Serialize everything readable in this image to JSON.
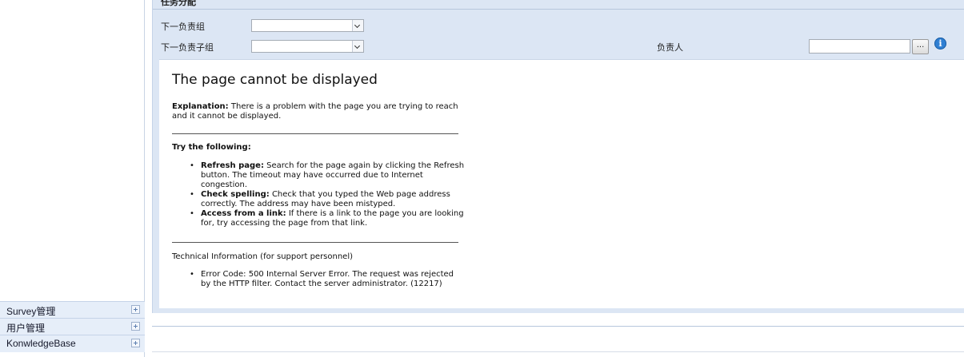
{
  "panel": {
    "title": "任务分配",
    "next_group_label": "下一负责组",
    "next_group_value": "",
    "next_subgroup_label": "下一负责子组",
    "next_subgroup_value": "",
    "owner_label": "负责人",
    "owner_value": "",
    "browse_label": "...",
    "info_glyph": "i"
  },
  "error_page": {
    "title": "The page cannot be displayed",
    "explanation_label": "Explanation:",
    "explanation_text": "There is a problem with the page you are trying to reach and it cannot be displayed.",
    "try_heading": "Try the following:",
    "tips": [
      {
        "label": "Refresh page:",
        "text": "Search for the page again by clicking the Refresh button. The timeout may have occurred due to Internet congestion."
      },
      {
        "label": "Check spelling:",
        "text": "Check that you typed the Web page address correctly. The address may have been mistyped."
      },
      {
        "label": "Access from a link:",
        "text": "If there is a link to the page you are looking for, try accessing the page from that link."
      }
    ],
    "tech_heading": "Technical Information (for support personnel)",
    "error_code": "Error Code: 500 Internal Server Error. The request was rejected by the HTTP filter. Contact the server administrator. (12217)"
  },
  "sidebar": {
    "items": [
      {
        "label": "Survey管理"
      },
      {
        "label": "用户管理"
      },
      {
        "label": "KonwledgeBase"
      }
    ]
  },
  "colors": {
    "panel_bg": "#dce6f4",
    "sidebar_item_bg": "#e6eef9",
    "info_blue": "#2f7fd3"
  },
  "icons": [
    "chevron-down-icon",
    "info-icon",
    "plus-icon"
  ]
}
